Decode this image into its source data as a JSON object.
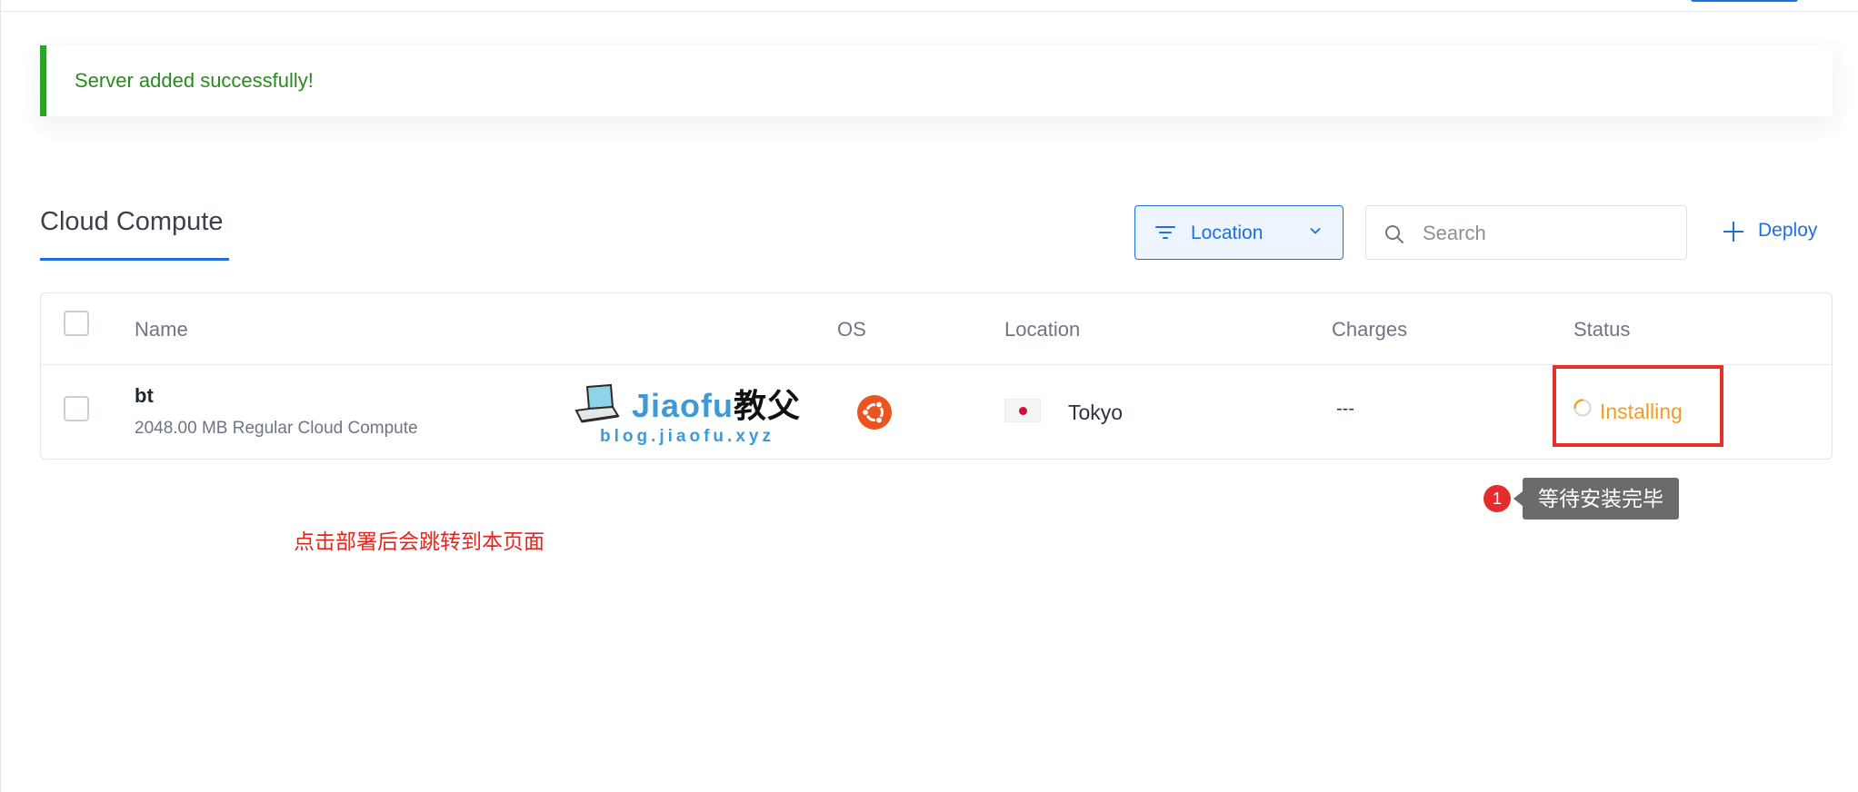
{
  "alert": {
    "message": "Server added successfully!",
    "color": "#2ea12b"
  },
  "page": {
    "title": "Cloud Compute"
  },
  "toolbar": {
    "filter_label": "Location",
    "search_placeholder": "Search",
    "deploy_label": "Deploy"
  },
  "table": {
    "columns": [
      "Name",
      "OS",
      "Location",
      "Charges",
      "Status"
    ],
    "rows": [
      {
        "name": "bt",
        "description": "2048.00 MB Regular Cloud Compute",
        "os_icon": "ubuntu-icon",
        "location": "Tokyo",
        "flag_icon": "japan-flag-icon",
        "charges": "---",
        "status": "Installing"
      }
    ]
  },
  "annotations": {
    "badge_number": "1",
    "tooltip": "等待安装完毕",
    "note": "点击部署后会跳转到本页面"
  },
  "watermark": {
    "brand": "Jiaofu",
    "brand_cn": "教父",
    "url": "blog.jiaofu.xyz"
  },
  "colors": {
    "accent": "#1e6fe0",
    "success": "#2b8a1f",
    "status_installing": "#f39a1f",
    "annotation_red": "#e4261f",
    "ubuntu": "#e95420"
  }
}
